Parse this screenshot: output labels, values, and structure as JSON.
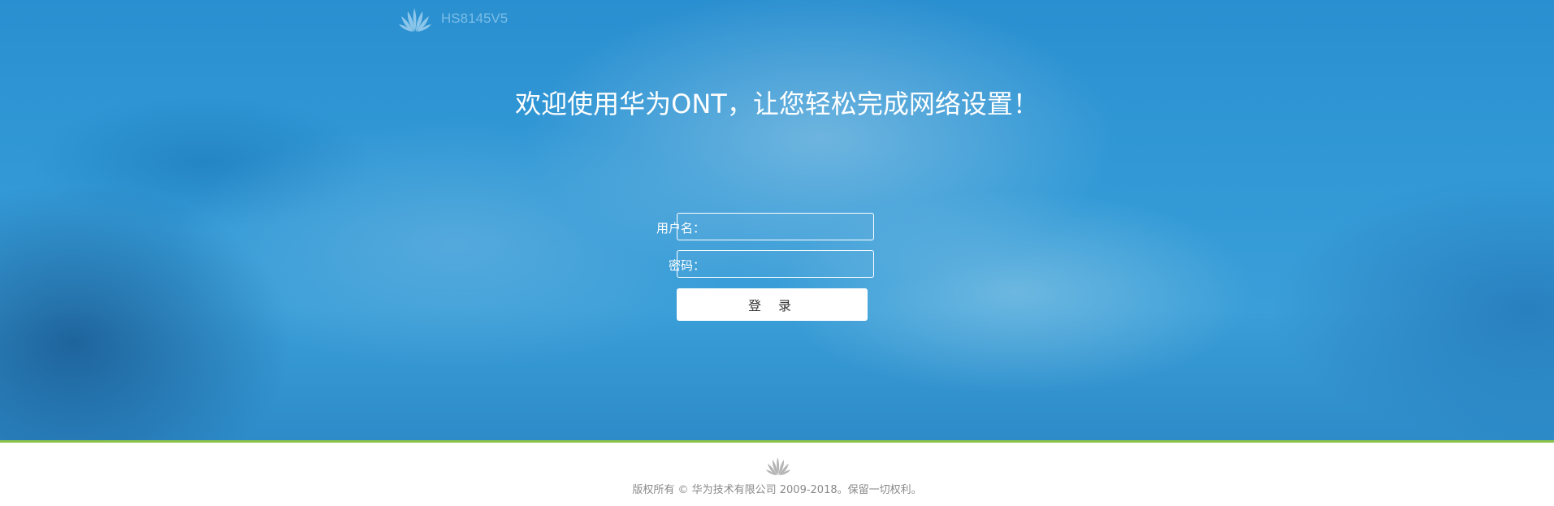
{
  "header": {
    "model": "HS8145V5",
    "logo_icon": "huawei-logo-icon"
  },
  "main": {
    "welcome": "欢迎使用华为ONT，让您轻松完成网络设置！"
  },
  "login": {
    "username_label": "用户名：",
    "username_value": "",
    "password_label": "密码：",
    "password_value": "",
    "submit_label": "登 录"
  },
  "footer": {
    "logo_icon": "huawei-logo-icon",
    "copyright": "版权所有 © 华为技术有限公司 2009-2018。保留一切权利。"
  },
  "colors": {
    "hero_blue": "#3299d6",
    "accent_line": "#8bc34a",
    "footer_text": "#8a8a8a"
  }
}
